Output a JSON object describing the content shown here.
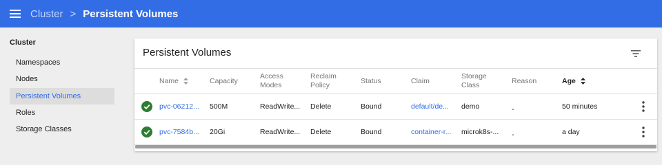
{
  "header": {
    "breadcrumb_parent": "Cluster",
    "breadcrumb_separator": ">",
    "breadcrumb_current": "Persistent Volumes",
    "color": "#326de6"
  },
  "sidebar": {
    "heading": "Cluster",
    "items": [
      {
        "label": "Namespaces"
      },
      {
        "label": "Nodes"
      },
      {
        "label": "Persistent Volumes",
        "active": true
      },
      {
        "label": "Roles"
      },
      {
        "label": "Storage Classes"
      }
    ]
  },
  "card": {
    "title": "Persistent Volumes",
    "filter_icon": "filter-list-icon"
  },
  "table": {
    "headers": {
      "name": "Name",
      "capacity": "Capacity",
      "access_modes_1": "Access",
      "access_modes_2": "Modes",
      "reclaim_policy_1": "Reclaim",
      "reclaim_policy_2": "Policy",
      "status": "Status",
      "claim": "Claim",
      "storage_class_1": "Storage",
      "storage_class_2": "Class",
      "reason": "Reason",
      "age": "Age"
    },
    "rows": [
      {
        "status_icon": "check-circle-icon",
        "name": "pvc-06212...",
        "capacity": "500M",
        "access_modes": "ReadWrite...",
        "reclaim_policy": "Delete",
        "status": "Bound",
        "claim": "default/de...",
        "storage_class": "demo",
        "reason": "-",
        "age": "50 minutes"
      },
      {
        "status_icon": "check-circle-icon",
        "name": "pvc-7584b...",
        "capacity": "20Gi",
        "access_modes": "ReadWrite...",
        "reclaim_policy": "Delete",
        "status": "Bound",
        "claim": "container-r...",
        "storage_class": "microk8s-...",
        "reason": "-",
        "age": "a day"
      }
    ]
  }
}
